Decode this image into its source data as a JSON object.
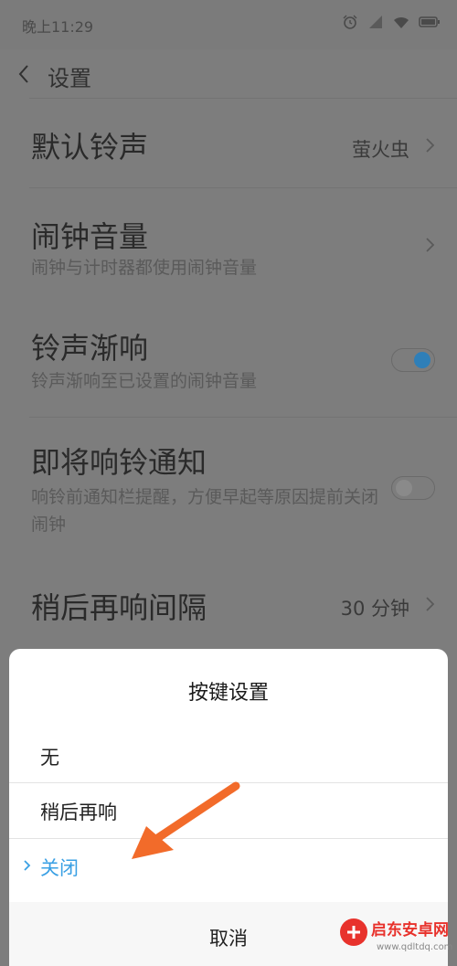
{
  "status_bar": {
    "time": "晚上11:29",
    "icons": [
      "alarm-icon",
      "signal-icon",
      "wifi-icon",
      "battery-icon"
    ]
  },
  "header": {
    "title": "设置"
  },
  "settings": {
    "ringtone": {
      "label": "默认铃声",
      "value": "萤火虫"
    },
    "volume": {
      "label": "闹钟音量",
      "sub": "闹钟与计时器都使用闹钟音量"
    },
    "fade_in": {
      "label": "铃声渐响",
      "sub": "铃声渐响至已设置的闹钟音量",
      "enabled": true
    },
    "notify": {
      "label": "即将响铃通知",
      "sub": "响铃前通知栏提醒，方便早起等原因提前关闭闹钟",
      "enabled": false
    },
    "snooze": {
      "label": "稍后再响间隔",
      "value": "30 分钟"
    }
  },
  "dialog": {
    "title": "按键设置",
    "options": [
      {
        "label": "无",
        "selected": false
      },
      {
        "label": "稍后再响",
        "selected": false
      },
      {
        "label": "关闭",
        "selected": true
      }
    ],
    "cancel": "取消"
  },
  "watermark": {
    "text": "启东安卓网",
    "url": "www.qdltdq.com"
  },
  "colors": {
    "accent": "#3aa0e4",
    "overlay": "#7d7d7d",
    "arrow": "#f26b2a"
  }
}
